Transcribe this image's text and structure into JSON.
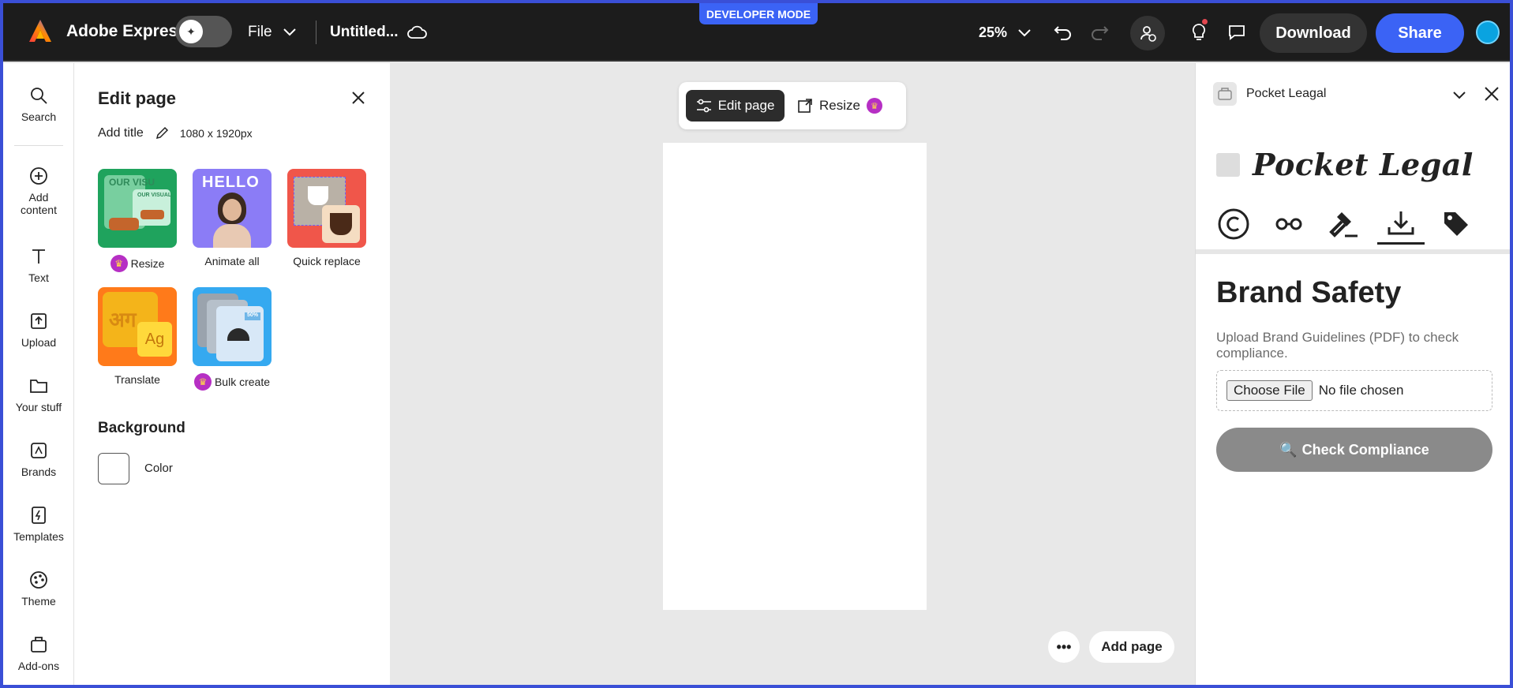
{
  "topbar": {
    "dev_mode": "DEVELOPER MODE",
    "app_name": "Adobe Express",
    "file_label": "File",
    "doc_title": "Untitled...",
    "zoom": "25%",
    "download_label": "Download",
    "share_label": "Share"
  },
  "rail": {
    "items": [
      {
        "label": "Search",
        "icon": "search-icon"
      },
      {
        "label": "Add content",
        "icon": "plus-circle-icon"
      },
      {
        "label": "Text",
        "icon": "text-icon"
      },
      {
        "label": "Upload",
        "icon": "upload-icon"
      },
      {
        "label": "Your stuff",
        "icon": "folder-icon"
      },
      {
        "label": "Brands",
        "icon": "brand-icon"
      },
      {
        "label": "Templates",
        "icon": "templates-icon"
      },
      {
        "label": "Theme",
        "icon": "palette-icon"
      },
      {
        "label": "Add-ons",
        "icon": "addons-icon"
      }
    ]
  },
  "edit_panel": {
    "title": "Edit page",
    "add_title": "Add title",
    "size": "1080 x 1920px",
    "tiles": [
      {
        "label": "Resize",
        "premium": true
      },
      {
        "label": "Animate all",
        "premium": false
      },
      {
        "label": "Quick replace",
        "premium": false
      },
      {
        "label": "Translate",
        "premium": false
      },
      {
        "label": "Bulk create",
        "premium": true
      }
    ],
    "tile_art": {
      "resize_big": "OUR VISU",
      "resize_small": "OUR VISUAL",
      "hello": "HELLO",
      "translate_big": "अग",
      "translate_small": "Ag",
      "bulk_tag": "50%"
    },
    "background_title": "Background",
    "color_label": "Color"
  },
  "canvas": {
    "edit_page_label": "Edit page",
    "resize_label": "Resize",
    "more_label": "•••",
    "add_page_label": "Add page"
  },
  "right_panel": {
    "app_title": "Pocket Leagal",
    "logo_text": "Pocket Legal",
    "tabs": [
      "copyright-icon",
      "glasses-icon",
      "gavel-icon",
      "download-icon",
      "tag-icon"
    ],
    "active_tab": 3,
    "heading": "Brand Safety",
    "description": "Upload Brand Guidelines (PDF) to check compliance.",
    "choose_file": "Choose File",
    "no_file": "No file chosen",
    "check_label": "Check Compliance",
    "check_icon": "🔍"
  },
  "colors": {
    "accent": "#3b63f5",
    "topbar": "#1c1c1c",
    "premium": "#b62fc4"
  }
}
